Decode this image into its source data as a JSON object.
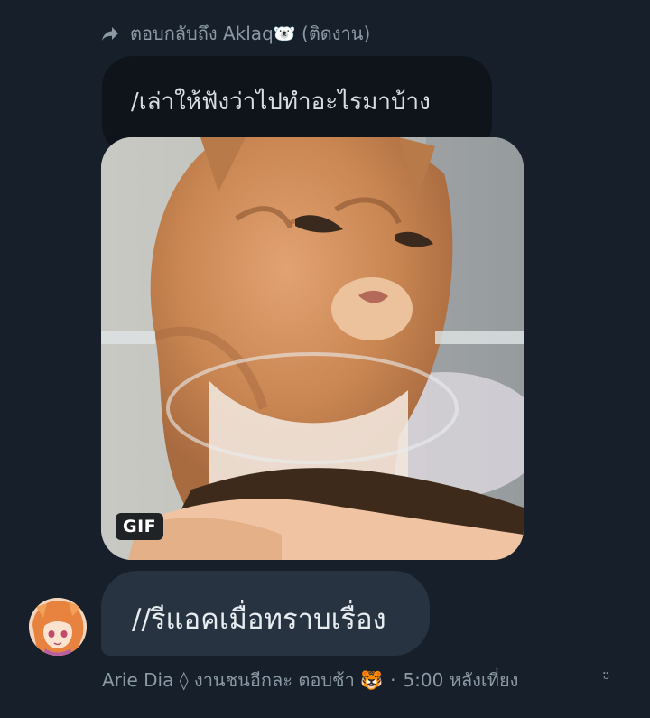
{
  "reply_header": {
    "icon": "reply-arrow-icon",
    "text": "ตอบกลับถึง Aklaq🐻‍❄️ (ติดงาน)"
  },
  "quoted_message": {
    "text": "/เล่าให้ฟังว่าไปทำอะไรมาบ้าง"
  },
  "gif": {
    "badge": "GIF"
  },
  "message": {
    "text": "//รีแอคเมื่อทราบเรื่อง"
  },
  "meta": {
    "author": "Arie Dia ◊ งานชนอีกละ ตอบช้า 🐯",
    "separator": "·",
    "time": "5:00 หลังเที่ยง"
  },
  "colors": {
    "background": "#17202a",
    "bubble": "#273340",
    "quoted_bubble": "#0f141a",
    "muted_text": "#8b98a5"
  }
}
